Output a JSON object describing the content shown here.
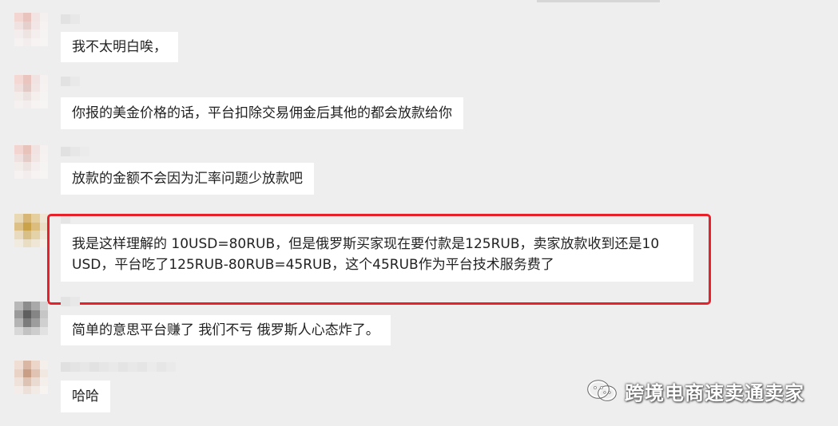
{
  "messages": [
    {
      "text": "我不太明白唉，"
    },
    {
      "text": "你报的美金价格的话，平台扣除交易佣金后其他的都会放款给你"
    },
    {
      "text": "放款的金额不会因为汇率问题少放款吧"
    },
    {
      "text": "我是这样理解的 10USD=80RUB，但是俄罗斯买家现在要付款是125RUB，卖家放款收到还是10 USD，平台吃了125RUB-80RUB=45RUB，这个45RUB作为平台技术服务费了"
    },
    {
      "text": "简单的意思平台赚了 我们不亏 俄罗斯人心态炸了。"
    },
    {
      "text": "哈哈"
    }
  ],
  "watermark": {
    "text": "跨境电商速卖通卖家",
    "icon": "wechat-icon"
  },
  "colors": {
    "highlight": "#e8202a",
    "background": "#eeeeee",
    "bubble": "#ffffff"
  }
}
